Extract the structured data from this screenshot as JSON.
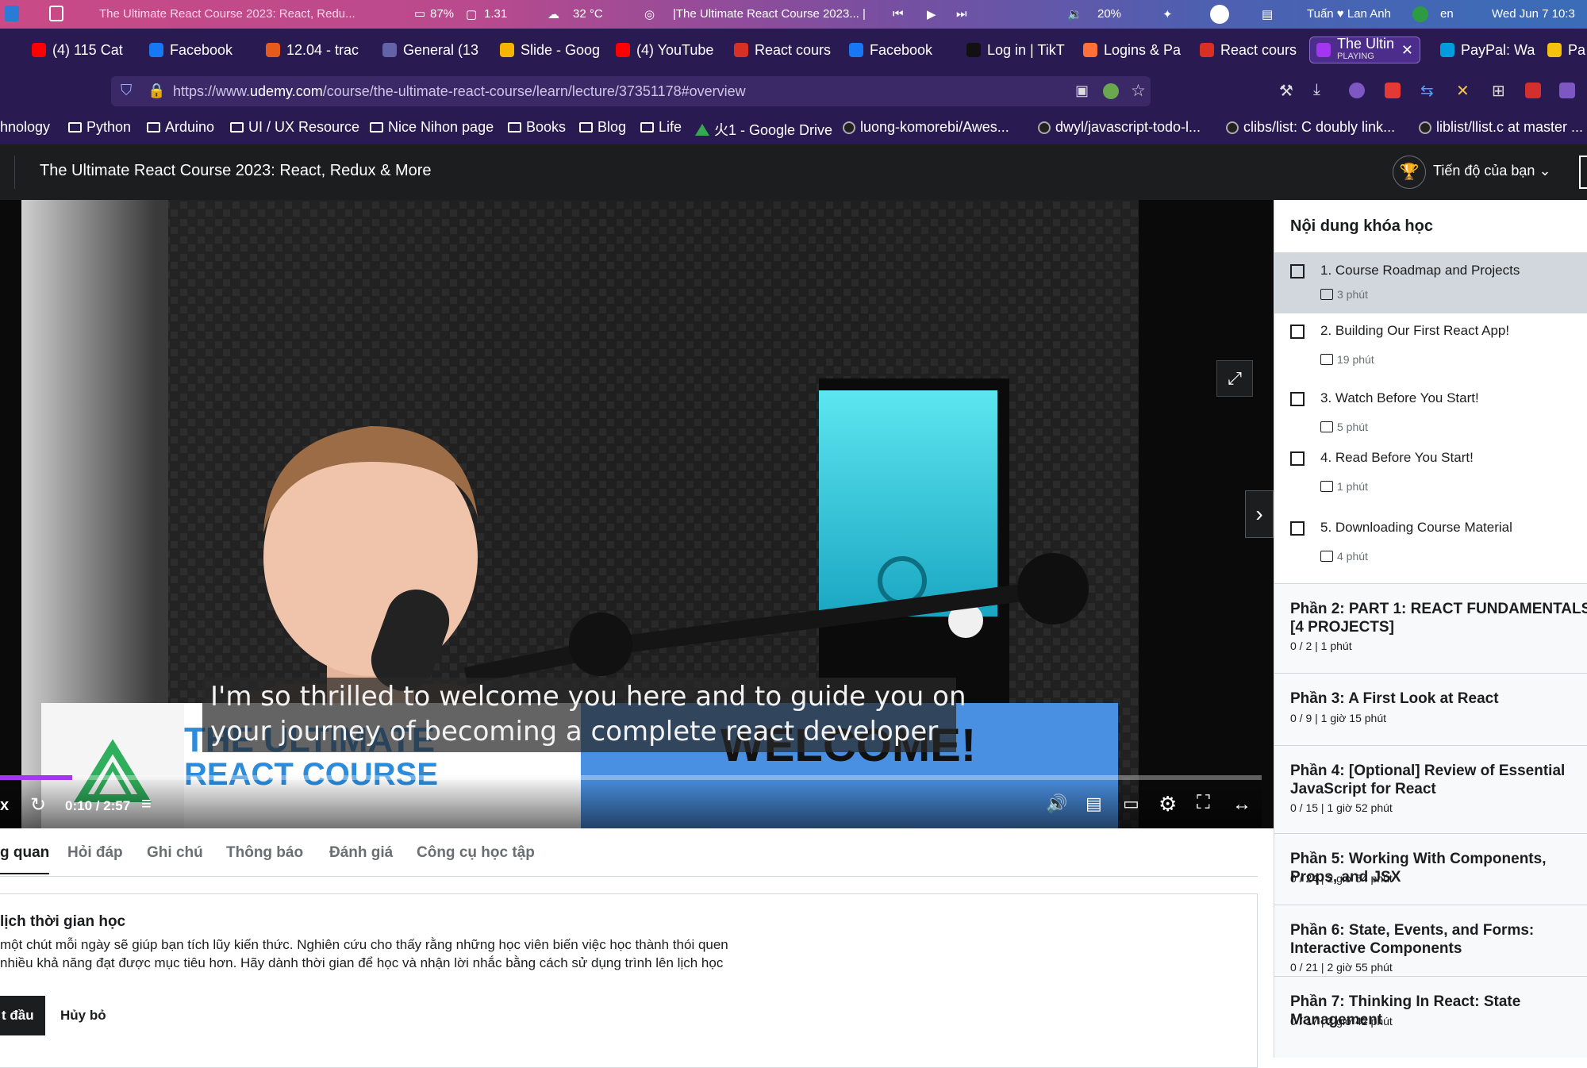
{
  "system_bar": {
    "window_title": "The Ultimate React Course 2023: React, Redu...",
    "battery": "87%",
    "load": "1.31",
    "temperature": "32 °C",
    "media_title": "|The Ultimate React Course 2023... |",
    "volume": "20%",
    "user": "Tuấn ♥ Lan Anh",
    "language": "en",
    "datetime": "Wed Jun 7  10:3"
  },
  "tabs": [
    {
      "label": "(4) 115 Cat",
      "color": "#ff0000"
    },
    {
      "label": "Facebook",
      "color": "#1877f2"
    },
    {
      "label": "12.04 - trac",
      "color": "#e65b1c"
    },
    {
      "label": "General (13",
      "color": "#6264a7"
    },
    {
      "label": "Slide - Goog",
      "color": "#f4b400"
    },
    {
      "label": "(4) YouTube",
      "color": "#ff0000"
    },
    {
      "label": "React cours",
      "color": "#d93025"
    },
    {
      "label": "Facebook",
      "color": "#1877f2"
    },
    {
      "label": "Log in | TikT",
      "color": "#111111"
    },
    {
      "label": "Logins & Pa",
      "color": "#ff7139"
    },
    {
      "label": "React cours",
      "color": "#d93025"
    },
    {
      "label": "The Ultin",
      "sub": "PLAYING",
      "color": "#a435f0",
      "active": true
    },
    {
      "label": "PayPal: Wal",
      "color": "#009cde"
    },
    {
      "label": "Pa",
      "color": "#f4c20d"
    }
  ],
  "url": {
    "prefix": "https://www.",
    "domain": "udemy.com",
    "path": "/course/the-ultimate-react-course/learn/lecture/37351178#overview"
  },
  "bookmarks": [
    {
      "label": "hnology",
      "icon": "folder-icon"
    },
    {
      "label": "Python",
      "icon": "folder-icon"
    },
    {
      "label": "Arduino",
      "icon": "folder-icon"
    },
    {
      "label": "UI / UX Resource",
      "icon": "folder-icon"
    },
    {
      "label": "Nice Nihon page",
      "icon": "folder-icon"
    },
    {
      "label": "Books",
      "icon": "folder-icon"
    },
    {
      "label": "Blog",
      "icon": "folder-icon"
    },
    {
      "label": "Life",
      "icon": "folder-icon"
    },
    {
      "label": "火1 - Google Drive",
      "icon": "drive-icon"
    },
    {
      "label": "luong-komorebi/Awes...",
      "icon": "github-icon"
    },
    {
      "label": "dwyl/javascript-todo-l...",
      "icon": "github-icon"
    },
    {
      "label": "clibs/list: C doubly link...",
      "icon": "github-icon"
    },
    {
      "label": "liblist/llist.c at master ...",
      "icon": "github-icon"
    }
  ],
  "header": {
    "course_title": "The Ultimate React Course 2023: React, Redux & More",
    "progress_label": "Tiến độ của bạn"
  },
  "video": {
    "subtitle_line1": "I'm so thrilled to welcome you here and to guide you on",
    "subtitle_line2": "your journey of becoming a complete react developer",
    "banner_title_top": "THE ULTIMATE",
    "banner_title_bottom": "REACT COURSE",
    "banner_welcome": "WELCOME!",
    "current_time": "0:10",
    "duration": "2:57",
    "time_display": "0:10 / 2:57",
    "progress_fraction": 0.057
  },
  "sidebar": {
    "title": "Nội dung khóa học",
    "lectures": [
      {
        "title": "1. Course Roadmap and Projects",
        "duration": "3 phút",
        "type": "video-icon",
        "active": true
      },
      {
        "title": "2. Building Our First React App!",
        "duration": "19 phút",
        "type": "video-icon"
      },
      {
        "title": "3. Watch Before You Start!",
        "duration": "5 phút",
        "type": "video-icon"
      },
      {
        "title": "4. Read Before You Start!",
        "duration": "1 phút",
        "type": "file-icon"
      },
      {
        "title": "5. Downloading Course Material",
        "duration": "4 phút",
        "type": "video-icon"
      }
    ],
    "sections": [
      {
        "title": "Phần 2: PART 1: REACT FUNDAMENTALS [4 PROJECTS]",
        "meta": "0 / 2 | 1 phút"
      },
      {
        "title": "Phần 3: A First Look at React",
        "meta": "0 / 9 | 1 giờ 15 phút"
      },
      {
        "title": "Phần 4: [Optional] Review of Essential JavaScript for React",
        "meta": "0 / 15 | 1 giờ 52 phút"
      },
      {
        "title": "Phần 5: Working With Components, Props, and JSX",
        "meta": "0 / 24 | 2 giờ 54 phút"
      },
      {
        "title": "Phần 6: State, Events, and Forms: Interactive Components",
        "meta": "0 / 21 | 2 giờ 55 phút"
      },
      {
        "title": "Phần 7: Thinking In React: State Management",
        "meta": "0 / 17 | 2 giờ 42 phút"
      }
    ]
  },
  "page_tabs": [
    "g quan",
    "Hỏi đáp",
    "Ghi chú",
    "Thông báo",
    "Đánh giá",
    "Công cụ học tập"
  ],
  "schedule": {
    "title": "lịch thời gian học",
    "text_line1": "một chút mỗi ngày sẽ giúp bạn tích lũy kiến thức. Nghiên cứu cho thấy rằng những học viên biến việc học thành thói quen",
    "text_line2": "nhiều khả năng đạt được mục tiêu hơn. Hãy dành thời gian để học và nhận lời nhắc bằng cách sử dụng trình lên lịch học",
    "start_button": "t đầu",
    "cancel_button": "Hủy bỏ"
  }
}
